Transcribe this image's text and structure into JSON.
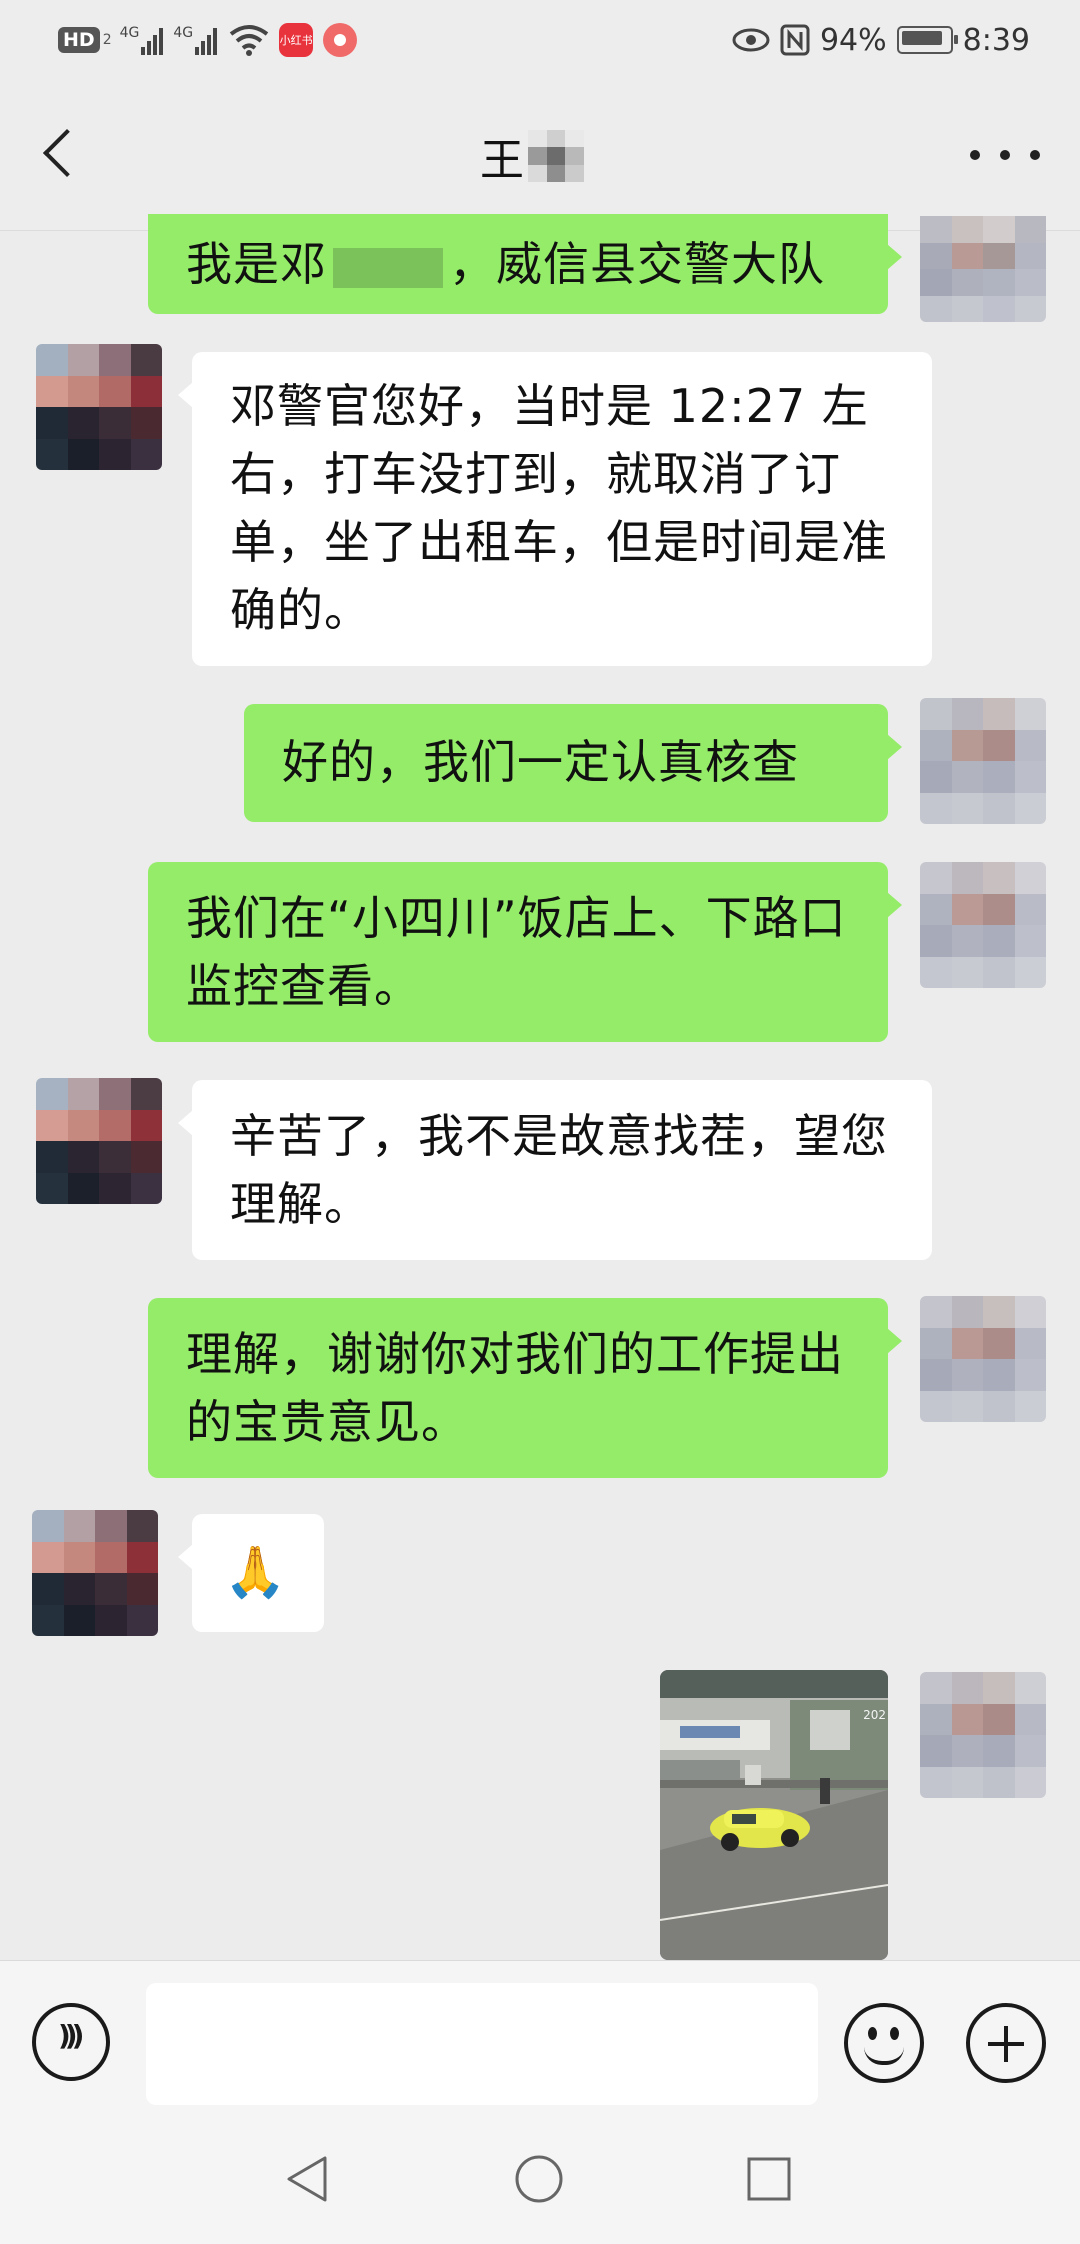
{
  "status_bar": {
    "hd": "HD",
    "hd_sub": "2",
    "net1": "4G",
    "net2": "4G",
    "app_badge": "小红书",
    "battery": "94%",
    "time": "8:39"
  },
  "header": {
    "contact_name": "王"
  },
  "messages": [
    {
      "side": "right",
      "text_before": "我是邓",
      "text_after": "，威信县交警大队"
    },
    {
      "side": "left",
      "text": "邓警官您好，当时是 12:27 左右，打车没打到，就取消了订单，坐了出租车，但是时间是准确的。"
    },
    {
      "side": "right",
      "text": "好的，我们一定认真核查"
    },
    {
      "side": "right",
      "text": "我们在“小四川”饭店上、下路口监控查看。"
    },
    {
      "side": "left",
      "text": "辛苦了，我不是故意找茬，望您理解。"
    },
    {
      "side": "right",
      "text": "理解，谢谢你对我们的工作提出的宝贵意见。"
    },
    {
      "side": "left",
      "emoji": "🙏"
    },
    {
      "side": "right",
      "image": "road-photo-yellow-car",
      "image_caption": "202"
    }
  ],
  "colors": {
    "bubble_sent": "#95ec69",
    "bubble_received": "#ffffff",
    "background": "#ececec"
  },
  "icons": [
    "back-icon",
    "more-icon",
    "voice-icon",
    "emoji-icon",
    "plus-icon",
    "nav-back-icon",
    "nav-home-icon",
    "nav-recent-icon"
  ]
}
